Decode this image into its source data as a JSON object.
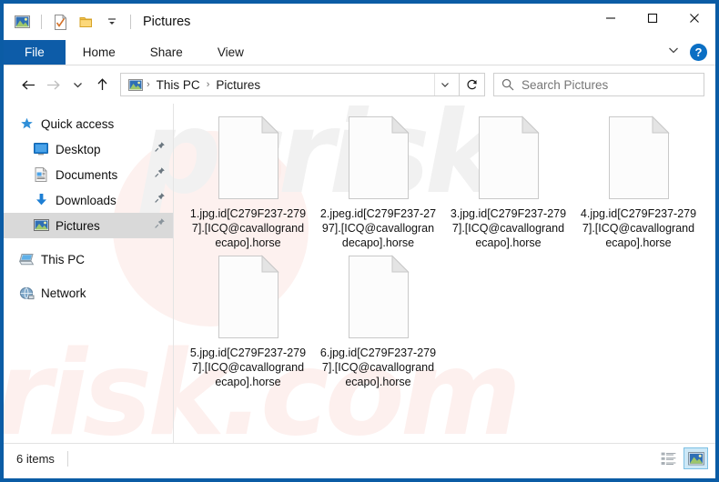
{
  "window": {
    "title": "Pictures",
    "accent_color": "#0b5ca5",
    "tab_active_color": "#0d5ca8"
  },
  "quick_access_toolbar": {
    "items": [
      {
        "name": "pictures-folder-icon",
        "label": "Pictures"
      },
      {
        "name": "properties-icon",
        "label": "Properties"
      },
      {
        "name": "new-folder-icon",
        "label": "New folder"
      },
      {
        "name": "customize-dropdown-icon",
        "label": "Customize Quick Access Toolbar"
      }
    ]
  },
  "window_controls": {
    "minimize": "—",
    "maximize": "☐",
    "close": "✕"
  },
  "ribbon": {
    "tabs": [
      {
        "label": "File",
        "active": true
      },
      {
        "label": "Home",
        "active": false
      },
      {
        "label": "Share",
        "active": false
      },
      {
        "label": "View",
        "active": false
      }
    ],
    "collapse_icon": "chevron-down-icon",
    "help_label": "?"
  },
  "navigation": {
    "back_icon": "←",
    "forward_icon": "→",
    "recent_icon": "⌄",
    "up_icon": "↑",
    "breadcrumb": [
      {
        "label": "This PC"
      },
      {
        "label": "Pictures"
      }
    ],
    "breadcrumb_separator": "›",
    "refresh_icon": "↻"
  },
  "search": {
    "placeholder": "Search Pictures",
    "icon": "search-icon"
  },
  "sidebar": {
    "items": [
      {
        "label": "Quick access",
        "icon": "star-icon",
        "level": 0,
        "pinned": false,
        "selected": false
      },
      {
        "label": "Desktop",
        "icon": "desktop-icon",
        "level": 1,
        "pinned": true,
        "selected": false
      },
      {
        "label": "Documents",
        "icon": "documents-icon",
        "level": 1,
        "pinned": true,
        "selected": false
      },
      {
        "label": "Downloads",
        "icon": "downloads-icon",
        "level": 1,
        "pinned": true,
        "selected": false
      },
      {
        "label": "Pictures",
        "icon": "pictures-icon",
        "level": 1,
        "pinned": true,
        "selected": true
      },
      {
        "label": "This PC",
        "icon": "this-pc-icon",
        "level": 0,
        "pinned": false,
        "selected": false
      },
      {
        "label": "Network",
        "icon": "network-icon",
        "level": 0,
        "pinned": false,
        "selected": false
      }
    ]
  },
  "files": [
    {
      "name": "1.jpg.id[C279F237-2797].[ICQ@cavallograndecapo].horse",
      "icon": "blank-file-icon"
    },
    {
      "name": "2.jpeg.id[C279F237-2797].[ICQ@cavallograndecapo].horse",
      "icon": "blank-file-icon"
    },
    {
      "name": "3.jpg.id[C279F237-2797].[ICQ@cavallograndecapo].horse",
      "icon": "blank-file-icon"
    },
    {
      "name": "4.jpg.id[C279F237-2797].[ICQ@cavallograndecapo].horse",
      "icon": "blank-file-icon"
    },
    {
      "name": "5.jpg.id[C279F237-2797].[ICQ@cavallograndecapo].horse",
      "icon": "blank-file-icon"
    },
    {
      "name": "6.jpg.id[C279F237-2797].[ICQ@cavallograndecapo].horse",
      "icon": "blank-file-icon"
    }
  ],
  "statusbar": {
    "item_count": "6 items",
    "views": [
      {
        "name": "details-view-button",
        "active": false
      },
      {
        "name": "large-icons-view-button",
        "active": true
      }
    ]
  },
  "watermark": {
    "top_text": "pcrisk",
    "bottom_text": "risk.com"
  }
}
